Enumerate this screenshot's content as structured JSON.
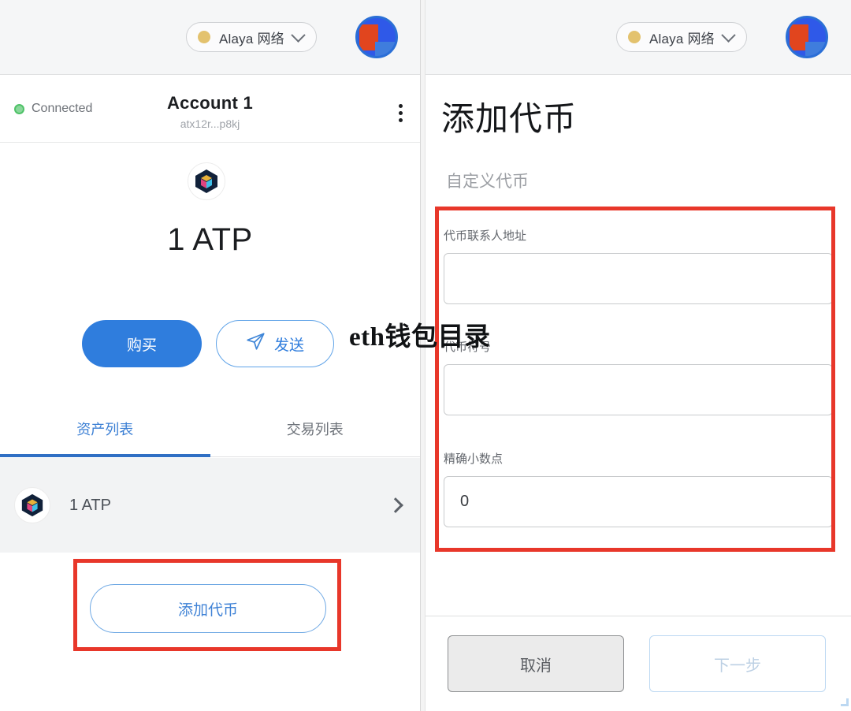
{
  "left_panel": {
    "network": {
      "label": "Alaya 网络",
      "dot_color": "#e3c26e",
      "chevron": "chevron-down-icon"
    },
    "account": {
      "status": "Connected",
      "status_color": "#4fc268",
      "name": "Account 1",
      "address": "atx12r...p8kj",
      "menu_icon": "kebab-menu-icon"
    },
    "balance": "1 ATP",
    "actions": {
      "buy": "购买",
      "send": "发送",
      "send_icon": "paper-plane-icon"
    },
    "tabs": [
      {
        "label": "资产列表",
        "active": true
      },
      {
        "label": "交易列表",
        "active": false
      }
    ],
    "assets": [
      {
        "name": "1 ATP",
        "icon": "atp-token-icon",
        "arrow": "chevron-right-icon"
      }
    ],
    "add_token_button": "添加代币"
  },
  "right_panel": {
    "network": {
      "label": "Alaya 网络",
      "dot_color": "#e3c26e",
      "chevron": "chevron-down-icon"
    },
    "title": "添加代币",
    "subtitle": "自定义代币",
    "fields": [
      {
        "label": "代币联系人地址",
        "value": "",
        "placeholder": ""
      },
      {
        "label": "代币符号",
        "value": "",
        "placeholder": ""
      },
      {
        "label": "精确小数点",
        "value": "0",
        "placeholder": ""
      }
    ],
    "footer": {
      "cancel": "取消",
      "next": "下一步"
    }
  },
  "overlay": {
    "watermark": "eth钱包目录"
  },
  "colors": {
    "accent_blue": "#2f7ddd",
    "highlight_red": "#e8372a",
    "tab_active": "#3b7fd4",
    "header_bg": "#f5f6f7",
    "list_bg": "#f2f3f4"
  }
}
